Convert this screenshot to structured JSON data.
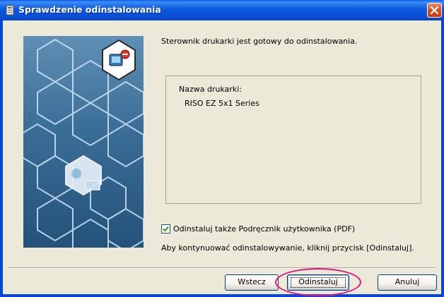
{
  "window": {
    "title": "Sprawdzenie odinstalowania",
    "title_icon": "installer-icon",
    "close_icon": "close-icon",
    "accent_color": "#0a5fe8"
  },
  "main": {
    "message": "Sterownik drukarki jest gotowy do odinstalowania.",
    "printer_name_label": "Nazwa drukarki:",
    "printer_name_value": "RISO EZ 5x1 Series",
    "checkbox_label": "Odinstaluj także Podręcznik użytkownika (PDF)",
    "checkbox_checked": true,
    "hint": "Aby kontynuować odinstalowywanie, kliknij przycisk [Odinstaluj]."
  },
  "buttons": {
    "back": "Wstecz",
    "uninstall": "Odinstaluj",
    "cancel": "Anuluj"
  },
  "annotation": {
    "highlight_color": "#e0157a"
  }
}
